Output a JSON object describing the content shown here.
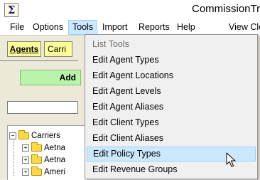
{
  "window": {
    "title": "CommissionTra",
    "app_icon_glyph": "Σ"
  },
  "menubar": {
    "items": [
      "File",
      "Options",
      "Tools",
      "Import",
      "Reports",
      "Help"
    ],
    "active": "Tools",
    "right_label": "View Clo"
  },
  "left_panel": {
    "agents_tab": "Agents",
    "carriers_tab": "Carri",
    "add_button": "Add",
    "search_value": ""
  },
  "tree": {
    "root": {
      "label": "Carriers",
      "expander": "−"
    },
    "children": [
      {
        "label": "Aetna",
        "expander": "+"
      },
      {
        "label": "Aetna",
        "expander": "+"
      },
      {
        "label": "Ameri",
        "expander": "+"
      }
    ]
  },
  "tools_menu": {
    "items": [
      {
        "label": "List Tools",
        "enabled": false
      },
      {
        "label": "Edit Agent Types",
        "enabled": true
      },
      {
        "label": "Edit Agent Locations",
        "enabled": true
      },
      {
        "label": "Edit Agent Levels",
        "enabled": true
      },
      {
        "label": "Edit Agent Aliases",
        "enabled": true
      },
      {
        "label": "Edit Client Types",
        "enabled": true
      },
      {
        "label": "Edit Client Aliases",
        "enabled": true
      },
      {
        "label": "Edit Policy Types",
        "enabled": true,
        "highlighted": true
      },
      {
        "label": "Edit Revenue Groups",
        "enabled": true
      }
    ]
  },
  "colors": {
    "highlight": "#cce8ff",
    "agents_tab": "#ffff99",
    "add_button": "#b8f5a8",
    "folder": "#ffd84a"
  },
  "icons": {
    "app": "sigma-app-icon",
    "tree_folder": "folder-icon",
    "cursor": "mouse-pointer-icon"
  }
}
